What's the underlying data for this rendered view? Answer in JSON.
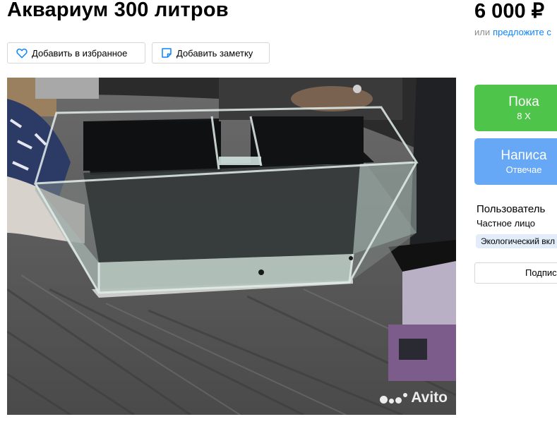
{
  "listing": {
    "title": "Аквариум 300 литров",
    "price": "6 000 ₽",
    "offer_prefix": "или",
    "offer_link": "предложите с"
  },
  "actions": {
    "favorite_label": "Добавить в избранное",
    "note_label": "Добавить заметку"
  },
  "photo": {
    "watermark": "Avito"
  },
  "contact": {
    "call_label": "Пока",
    "call_sub": "8 Х",
    "write_label": "Написа",
    "write_sub": "Отвечае"
  },
  "seller": {
    "name": "Пользователь",
    "type": "Частное лицо",
    "badge": "Экологический вкл",
    "subscribe_label": "Подпис"
  },
  "colors": {
    "call_green": "#4fc44a",
    "write_blue": "#66a8f6",
    "link_blue": "#0a84ff"
  },
  "icons": [
    "heart-icon",
    "note-icon",
    "avito-logo-dots"
  ]
}
